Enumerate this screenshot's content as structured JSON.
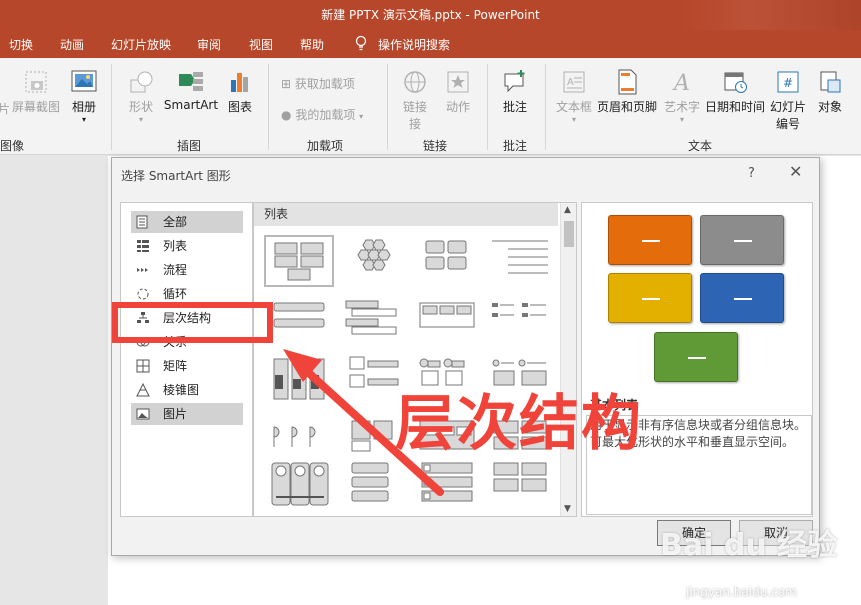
{
  "window": {
    "title": "新建 PPTX 演示文稿.pptx  -  PowerPoint"
  },
  "menu": {
    "tabs": [
      "切换",
      "动画",
      "幻灯片放映",
      "审阅",
      "视图",
      "帮助",
      "操作说明搜索"
    ]
  },
  "ribbon": {
    "images_group": {
      "screenshot": "屏幕截图",
      "album": "相册",
      "label": "图像",
      "cut_label": "片"
    },
    "illustrations_group": {
      "shapes": "形状",
      "smartart": "SmartArt",
      "chart": "图表",
      "label": "插图"
    },
    "addins_group": {
      "get_addins": "获取加载项",
      "my_addins": "我的加载项",
      "label": "加载项"
    },
    "links_group": {
      "link": "链接",
      "link2": "接",
      "action": "动作",
      "label": "链接"
    },
    "comments_group": {
      "comment": "批注",
      "label": "批注"
    },
    "text_group": {
      "textbox": "文本框",
      "header_footer": "页眉和页脚",
      "wordart": "艺术字",
      "datetime": "日期和时间",
      "slide_number_1": "幻灯片",
      "slide_number_2": "编号",
      "object": "对象",
      "label": "文本"
    }
  },
  "dialog": {
    "title": "选择 SmartArt 图形",
    "help": "?",
    "close": "✕",
    "categories": [
      {
        "label": "全部",
        "icon": "all-icon",
        "selected": true
      },
      {
        "label": "列表",
        "icon": "list-icon",
        "selected": false
      },
      {
        "label": "流程",
        "icon": "process-icon",
        "selected": false
      },
      {
        "label": "循环",
        "icon": "cycle-icon",
        "selected": false
      },
      {
        "label": "层次结构",
        "icon": "hierarchy-icon",
        "selected": false
      },
      {
        "label": "关系",
        "icon": "relationship-icon",
        "selected": false
      },
      {
        "label": "矩阵",
        "icon": "matrix-icon",
        "selected": false
      },
      {
        "label": "棱锥图",
        "icon": "pyramid-icon",
        "selected": false
      },
      {
        "label": "图片",
        "icon": "picture-icon",
        "selected": true
      }
    ],
    "layout_header": "列表",
    "preview": {
      "title": "基本列表",
      "description": "用于显示非有序信息块或者分组信息块。可最大化形状的水平和垂直显示空间。",
      "colors": [
        "#e46c0a",
        "#8c8c8c",
        "#e3b000",
        "#2e64b4",
        "#5f9a37"
      ]
    },
    "ok": "确定",
    "cancel": "取消"
  },
  "annotation": {
    "text": "层次结构"
  },
  "watermark": {
    "main": "Bai du 经验",
    "sub": "jingyan.baidu.com"
  }
}
